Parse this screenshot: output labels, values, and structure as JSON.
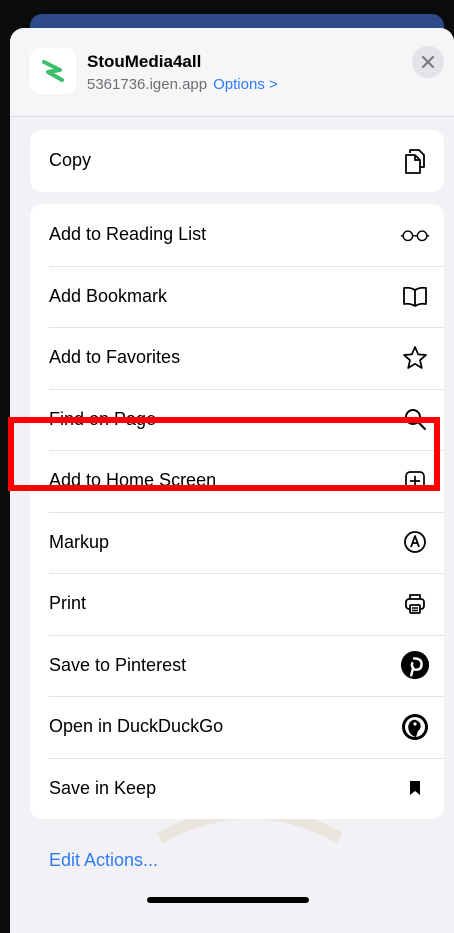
{
  "header": {
    "app_name": "StouMedia4all",
    "url": "5361736.igen.app",
    "options_label": "Options >"
  },
  "copy_group": [
    {
      "label": "Copy",
      "icon": "copy-icon"
    }
  ],
  "actions_group": [
    {
      "label": "Add to Reading List",
      "icon": "glasses-icon"
    },
    {
      "label": "Add Bookmark",
      "icon": "book-icon"
    },
    {
      "label": "Add to Favorites",
      "icon": "star-icon"
    },
    {
      "label": "Find on Page",
      "icon": "search-icon"
    },
    {
      "label": "Add to Home Screen",
      "icon": "plus-square-icon"
    },
    {
      "label": "Markup",
      "icon": "markup-icon"
    },
    {
      "label": "Print",
      "icon": "printer-icon"
    },
    {
      "label": "Save to Pinterest",
      "icon": "pinterest-icon"
    },
    {
      "label": "Open in DuckDuckGo",
      "icon": "duckduckgo-icon"
    },
    {
      "label": "Save in Keep",
      "icon": "bookmark-icon"
    }
  ],
  "footer": {
    "edit_actions_label": "Edit Actions..."
  },
  "colors": {
    "accent": "#2f7cf6",
    "highlight": "#ff0000",
    "sheet_bg": "#f2f2f6",
    "app_icon_green": "#3bbf6a"
  }
}
